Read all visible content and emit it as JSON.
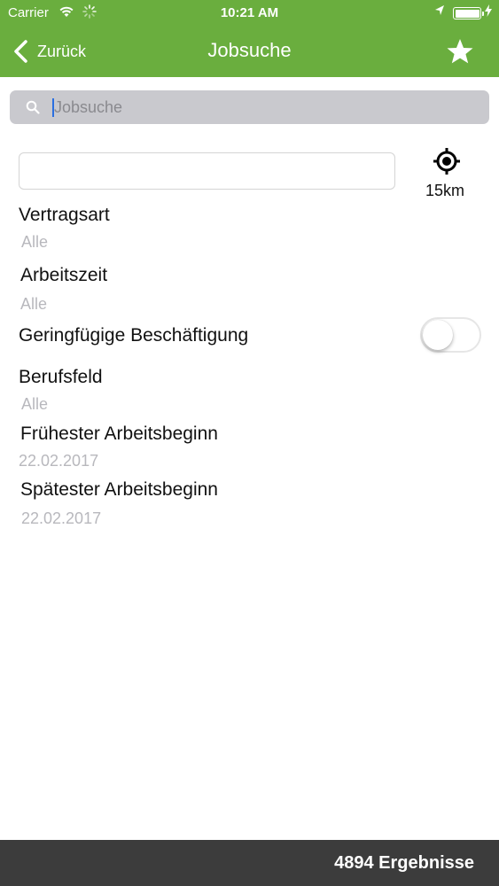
{
  "status_bar": {
    "carrier": "Carrier",
    "time": "10:21 AM",
    "wifi_icon": "wifi-icon",
    "activity_icon": "activity-spinner-icon",
    "location_icon": "location-arrow-icon",
    "battery_icon": "battery-charging-icon"
  },
  "nav": {
    "back_label": "Zurück",
    "title": "Jobsuche",
    "favorite_icon": "star-icon"
  },
  "search": {
    "placeholder": "Jobsuche",
    "value": ""
  },
  "location": {
    "value": "",
    "radius": "15km",
    "locate_icon": "locate-crosshair-icon"
  },
  "filters": {
    "vertragsart": {
      "label": "Vertragsart",
      "value": "Alle"
    },
    "arbeitszeit": {
      "label": "Arbeitszeit",
      "value": "Alle"
    },
    "geringfuegig": {
      "label": "Geringfügige Beschäftigung",
      "enabled": false
    },
    "berufsfeld": {
      "label": "Berufsfeld",
      "value": "Alle"
    },
    "fruehester_beginn": {
      "label": "Frühester Arbeitsbeginn",
      "value": "22.02.2017"
    },
    "spaetester_beginn": {
      "label": "Spätester Arbeitsbeginn",
      "value": "22.02.2017"
    }
  },
  "footer": {
    "results": "4894 Ergebnisse"
  },
  "colors": {
    "accent": "#6aae3e",
    "footer_bg": "#3c3c3c",
    "placeholder_gray": "#b8b8bd"
  }
}
